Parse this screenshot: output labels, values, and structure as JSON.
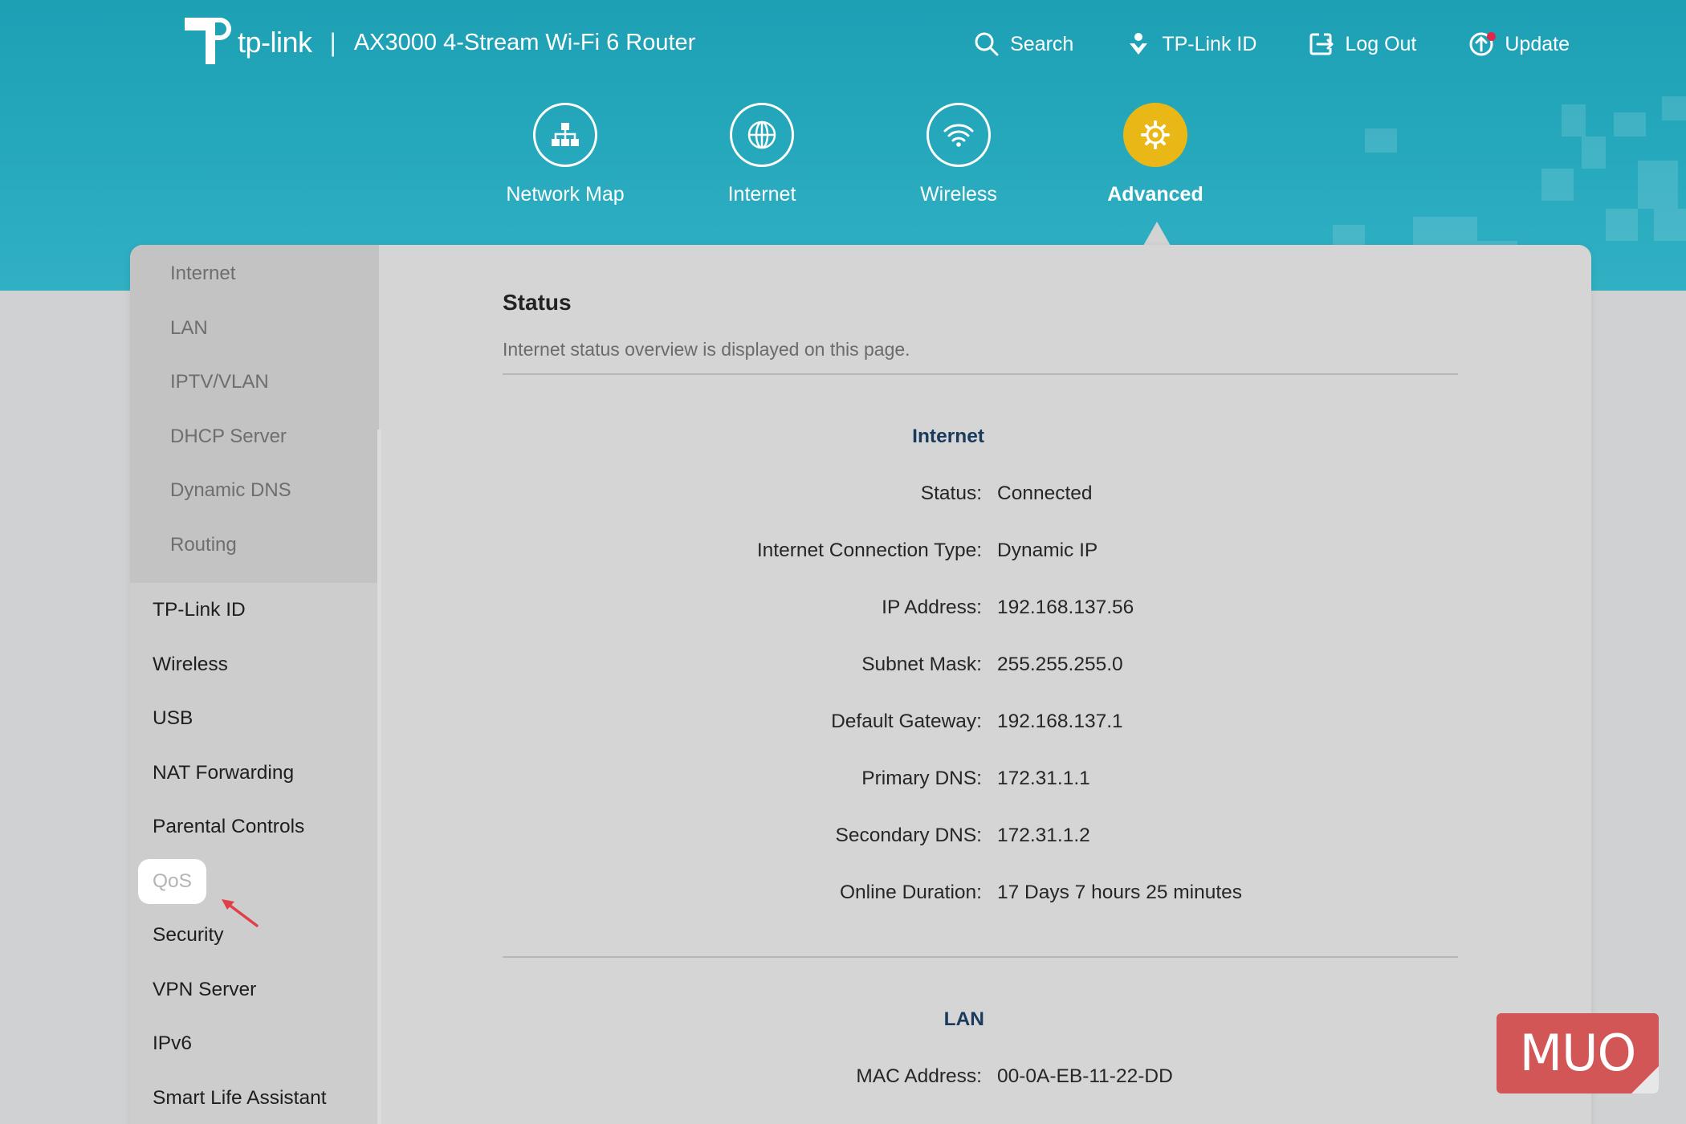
{
  "brand": {
    "logo_text": "tp-link",
    "separator": "|",
    "product": "AX3000 4-Stream Wi-Fi 6 Router"
  },
  "top_actions": [
    {
      "label": "Search",
      "icon": "search-icon"
    },
    {
      "label": "TP-Link ID",
      "icon": "tplink-id-icon"
    },
    {
      "label": "Log Out",
      "icon": "logout-icon"
    },
    {
      "label": "Update",
      "icon": "update-icon"
    }
  ],
  "main_nav": [
    {
      "label": "Network Map",
      "icon": "network-map-icon",
      "active": false
    },
    {
      "label": "Internet",
      "icon": "globe-icon",
      "active": false
    },
    {
      "label": "Wireless",
      "icon": "wifi-icon",
      "active": false
    },
    {
      "label": "Advanced",
      "icon": "gear-icon",
      "active": true
    }
  ],
  "sidebar": {
    "sub_items": [
      "Internet",
      "LAN",
      "IPTV/VLAN",
      "DHCP Server",
      "Dynamic DNS",
      "Routing"
    ],
    "items": [
      "TP-Link ID",
      "Wireless",
      "USB",
      "NAT Forwarding",
      "Parental Controls",
      "QoS",
      "Security",
      "VPN Server",
      "IPv6",
      "Smart Life Assistant"
    ],
    "highlighted": "QoS"
  },
  "content": {
    "title": "Status",
    "description": "Internet status overview is displayed on this page.",
    "internet": {
      "title": "Internet",
      "rows": [
        {
          "label": "Status:",
          "value": "Connected"
        },
        {
          "label": "Internet Connection Type:",
          "value": "Dynamic IP"
        },
        {
          "label": "IP Address:",
          "value": "192.168.137.56"
        },
        {
          "label": "Subnet Mask:",
          "value": "255.255.255.0"
        },
        {
          "label": "Default Gateway:",
          "value": "192.168.137.1"
        },
        {
          "label": "Primary DNS:",
          "value": "172.31.1.1"
        },
        {
          "label": "Secondary DNS:",
          "value": "172.31.1.2"
        },
        {
          "label": "Online Duration:",
          "value": "17 Days 7 hours 25 minutes"
        }
      ]
    },
    "lan": {
      "title": "LAN",
      "rows": [
        {
          "label": "MAC Address:",
          "value": "00-0A-EB-11-22-DD"
        }
      ]
    }
  },
  "watermark": "MUO",
  "colors": {
    "header": "#27a9bd",
    "active_nav": "#e9b716",
    "section_title": "#1a3a5c",
    "watermark_bg": "#d25656",
    "arrow": "#e0404a"
  }
}
